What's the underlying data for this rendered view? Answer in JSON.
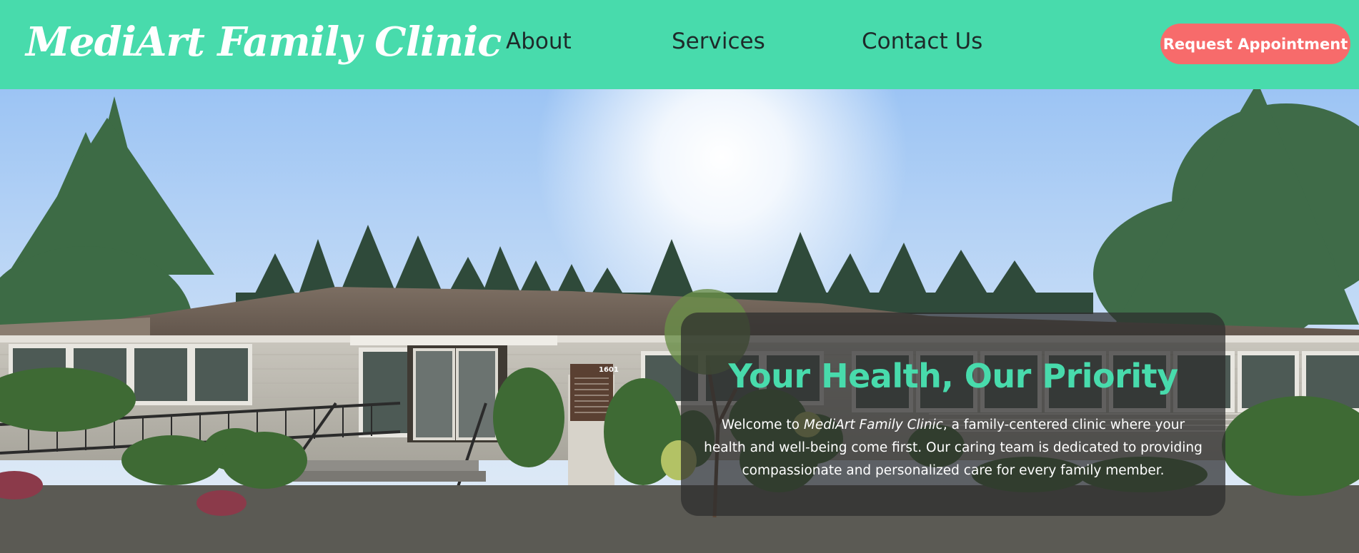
{
  "header": {
    "brand": "MediArt Family Clinic",
    "nav": [
      {
        "label": "About"
      },
      {
        "label": "Services"
      },
      {
        "label": "Contact Us"
      }
    ],
    "cta_label": "Request Appointment"
  },
  "hero": {
    "building_sign_number": "1601",
    "card": {
      "title": "Your Health, Our Priority",
      "body_prefix": "Welcome to ",
      "body_brand": "MediArt Family Clinic",
      "body_suffix": ", a family-centered clinic where your health and well-being come first. Our caring team is dedicated to providing compassionate and personalized care for every family member."
    }
  },
  "colors": {
    "header_bg": "#48dbac",
    "accent_teal": "#48dbac",
    "cta_bg": "#f76b6b",
    "card_bg": "rgba(45,45,45,0.72)"
  }
}
